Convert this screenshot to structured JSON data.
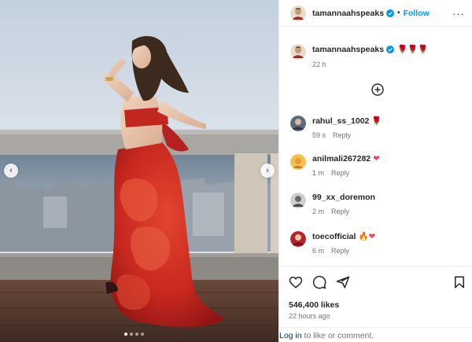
{
  "post": {
    "username": "tamannaahspeaks",
    "separator": "•",
    "follow_label": "Follow",
    "more_label": "···",
    "carousel_dots": 4,
    "active_dot": 1
  },
  "caption": {
    "username": "tamannaahspeaks",
    "emoji": "🌹🌹🌹",
    "time": "22 h"
  },
  "comments": [
    {
      "username": "rahul_ss_1002",
      "text": "🌹",
      "time": "59 s",
      "reply_label": "Reply",
      "avatar_color": "#5b6b7a"
    },
    {
      "username": "anilmali267282",
      "text": "❤",
      "time": "1 m",
      "reply_label": "Reply",
      "avatar_color": "#e9a93a"
    },
    {
      "username": "99_xx_doremon",
      "text": "",
      "time": "2 m",
      "reply_label": "Reply",
      "avatar_color": "#6a6a6a"
    },
    {
      "username": "toecofficial",
      "text": "🔥❤",
      "time": "6 m",
      "reply_label": "Reply",
      "avatar_color": "#b4242c"
    }
  ],
  "footer": {
    "likes": "546,400 likes",
    "ago": "22 hours ago",
    "login_link": "Log in",
    "login_rest": " to like or comment."
  },
  "colors": {
    "accent": "#0095f6",
    "verified": "#0095f6",
    "heart": "#ed4956"
  }
}
